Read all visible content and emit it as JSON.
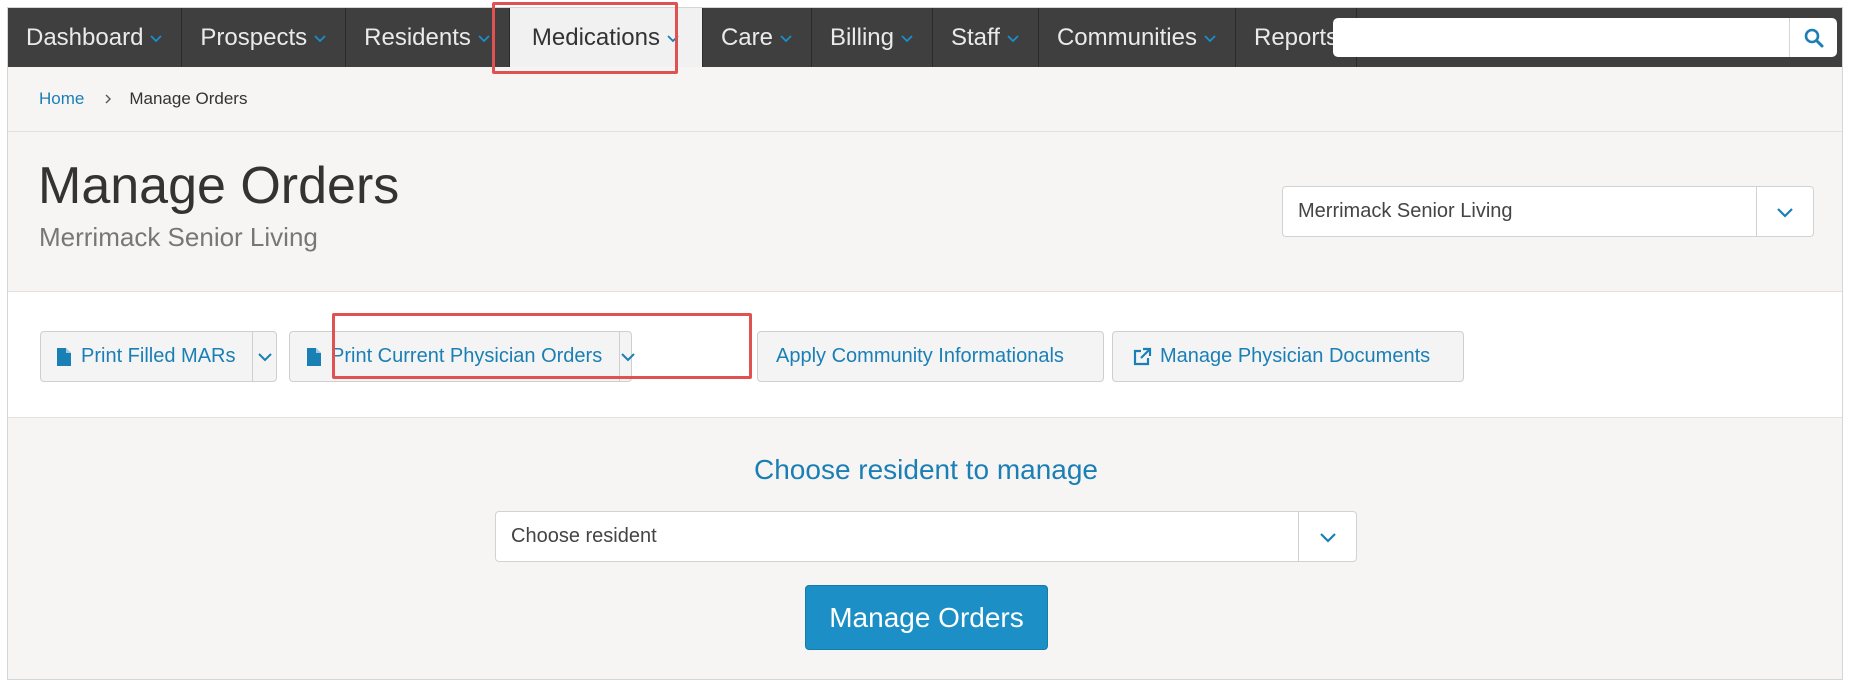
{
  "nav": {
    "items": [
      {
        "label": "Dashboard",
        "has_menu": true
      },
      {
        "label": "Prospects",
        "has_menu": true
      },
      {
        "label": "Residents",
        "has_menu": true
      },
      {
        "label": "Medications",
        "has_menu": true,
        "active": true
      },
      {
        "label": "Care",
        "has_menu": true
      },
      {
        "label": "Billing",
        "has_menu": true
      },
      {
        "label": "Staff",
        "has_menu": true
      },
      {
        "label": "Communities",
        "has_menu": true
      },
      {
        "label": "Reports",
        "has_menu": false
      }
    ],
    "search": {
      "value": "",
      "placeholder": ""
    }
  },
  "breadcrumb": {
    "home": "Home",
    "current": "Manage Orders"
  },
  "header": {
    "title": "Manage Orders",
    "subtitle": "Merrimack Senior Living",
    "community_select": "Merrimack Senior Living"
  },
  "toolbar": {
    "print_mars": "Print Filled MARs",
    "print_orders": "Print Current Physician Orders",
    "apply_informationals": "Apply Community Informationals",
    "manage_documents": "Manage Physician Documents"
  },
  "main": {
    "heading": "Choose resident to manage",
    "resident_select": "Choose resident",
    "submit": "Manage Orders"
  },
  "colors": {
    "nav_bg": "#3f3f3f",
    "accent": "#1a7fb5",
    "primary_button": "#1b8fc6",
    "highlight": "#e05252"
  }
}
